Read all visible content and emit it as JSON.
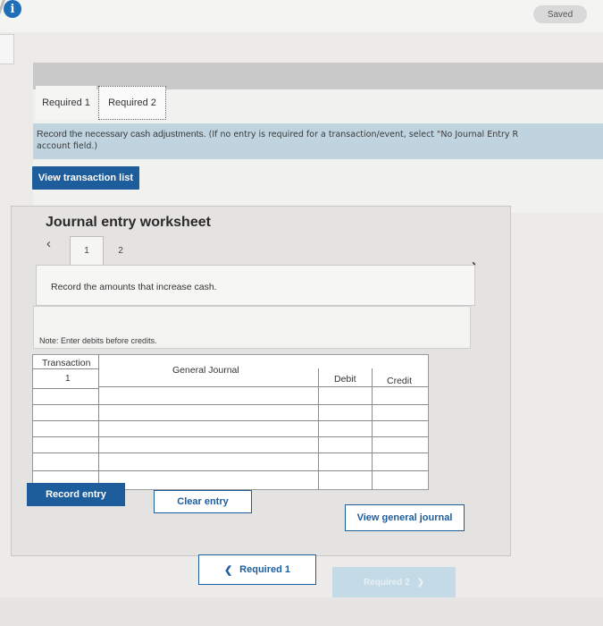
{
  "header": {
    "info_icon": "i",
    "saved_label": "Saved"
  },
  "tabs": [
    {
      "label": "Required 1"
    },
    {
      "label": "Required 2"
    }
  ],
  "instruction": {
    "main": "Record the necessary cash adjustments.",
    "paren": "(If no entry is required for a transaction/event, select \"No Journal Entry R",
    "line2": "account field.)"
  },
  "view_transaction_list_label": "View transaction list",
  "worksheet": {
    "title": "Journal entry worksheet",
    "prev_icon": "chevron-left-icon",
    "next_icon": "chevron-right-icon",
    "subtabs": [
      "1",
      "2"
    ],
    "description": "Record the amounts that increase cash.",
    "note": "Note: Enter debits before credits.",
    "table": {
      "headers": {
        "transaction": "Transaction",
        "general_journal": "General Journal",
        "debit": "Debit",
        "credit": "Credit"
      },
      "rows": [
        {
          "transaction": "1",
          "general_journal": "",
          "debit": "",
          "credit": ""
        },
        {
          "transaction": "",
          "general_journal": "",
          "debit": "",
          "credit": ""
        },
        {
          "transaction": "",
          "general_journal": "",
          "debit": "",
          "credit": ""
        },
        {
          "transaction": "",
          "general_journal": "",
          "debit": "",
          "credit": ""
        },
        {
          "transaction": "",
          "general_journal": "",
          "debit": "",
          "credit": ""
        },
        {
          "transaction": "",
          "general_journal": "",
          "debit": "",
          "credit": ""
        }
      ]
    }
  },
  "buttons": {
    "record_entry": "Record entry",
    "clear_entry": "Clear entry",
    "view_general_journal": "View general journal"
  },
  "nav": {
    "prev_label": "Required 1",
    "next_label": "Required 2"
  },
  "colors": {
    "accent": "#1e5d9b",
    "instruction_bg": "#bfd4df"
  }
}
